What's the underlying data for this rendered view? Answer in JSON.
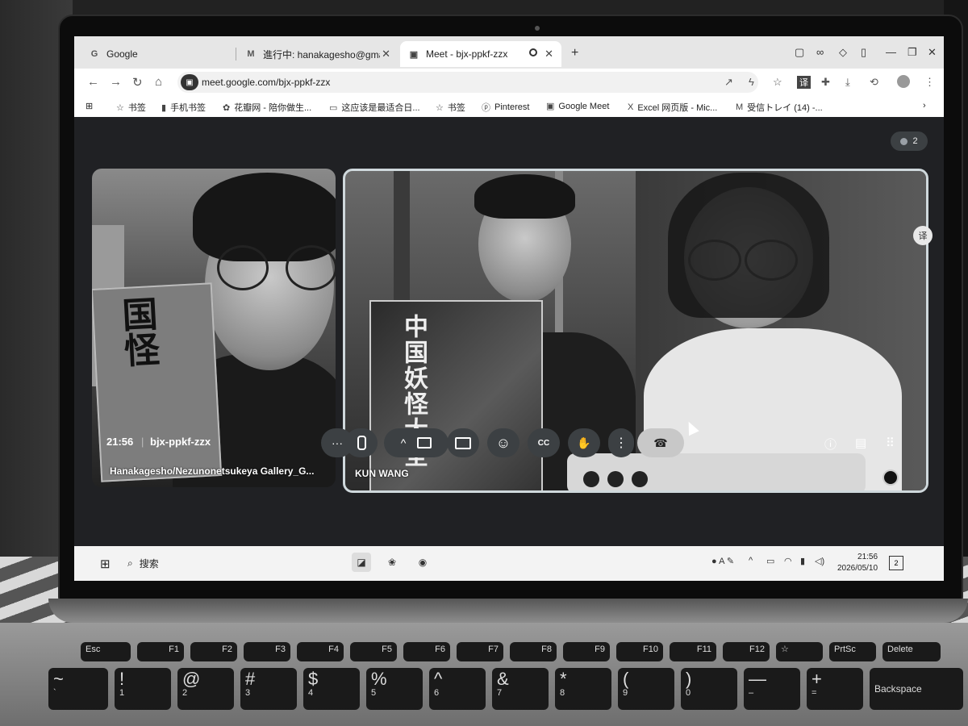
{
  "browser": {
    "tabs": [
      {
        "title": "Google",
        "favicon": "G",
        "icon": "google-icon"
      },
      {
        "title": "進行中: hanakagesho@gmail.",
        "favicon": "M",
        "icon": "gmail-icon"
      },
      {
        "title": "Meet - bjx-ppkf-zzx",
        "favicon": "▣",
        "icon": "meet-icon"
      }
    ],
    "new_tab": "+",
    "url": "meet.google.com/bjx-ppkf-zzx",
    "bookmarks": [
      {
        "label": "书签",
        "icon": "star-icon"
      },
      {
        "label": "手机书签",
        "icon": "mobile-icon"
      },
      {
        "label": "花瓣网 - 陪你做生...",
        "icon": "huaban-icon"
      },
      {
        "label": "这应该是最适合日...",
        "icon": "bilibili-icon"
      },
      {
        "label": "书签",
        "icon": "star-icon"
      },
      {
        "label": "Pinterest",
        "icon": "pinterest-icon"
      },
      {
        "label": "Google Meet",
        "icon": "meet-icon"
      },
      {
        "label": "Excel 网页版 - Mic...",
        "icon": "excel-icon"
      },
      {
        "label": "受信トレイ (14) -...",
        "icon": "gmail-icon"
      }
    ],
    "more_bookmarks": "›"
  },
  "meet": {
    "participant_count": "2",
    "participants": [
      {
        "name": "Hanakagesho/Nezunonetsukeya Gallery_G..."
      },
      {
        "name": "KUN WANG"
      }
    ],
    "book_left_title": "国怪",
    "book_right_title": "中国妖怪大全",
    "translate_label": "译",
    "time": "21:56",
    "separator": "|",
    "meeting_code": "bjx-ppkf-zzx",
    "controls": [
      {
        "id": "more-options",
        "symbol": "···"
      },
      {
        "id": "mic",
        "symbol": "🎤"
      },
      {
        "id": "expand",
        "symbol": "^"
      },
      {
        "id": "camera",
        "symbol": "■"
      },
      {
        "id": "present",
        "symbol": "⇡"
      },
      {
        "id": "reactions",
        "symbol": "☺"
      },
      {
        "id": "captions",
        "symbol": "CC"
      },
      {
        "id": "raise-hand",
        "symbol": "✋"
      },
      {
        "id": "overflow",
        "symbol": "⋮"
      },
      {
        "id": "end-call",
        "symbol": "☎"
      }
    ]
  },
  "taskbar": {
    "search_placeholder": "搜索",
    "time": "21:56",
    "date": "2026/05/10",
    "notification_count": "2"
  },
  "keyboard": {
    "fn_row": [
      "Esc",
      "F1",
      "F2",
      "F3",
      "F4",
      "F5",
      "F6",
      "F7",
      "F8",
      "F9",
      "F10",
      "F11",
      "F12",
      "PrtSc",
      "Delete"
    ],
    "fn_sub": [
      "",
      "Ins"
    ],
    "num_row": [
      {
        "top": "~",
        "bottom": "`"
      },
      {
        "top": "!",
        "bottom": "1"
      },
      {
        "top": "@",
        "bottom": "2"
      },
      {
        "top": "#",
        "bottom": "3"
      },
      {
        "top": "$",
        "bottom": "4"
      },
      {
        "top": "%",
        "bottom": "5"
      },
      {
        "top": "^",
        "bottom": "6"
      },
      {
        "top": "&",
        "bottom": "7"
      },
      {
        "top": "*",
        "bottom": "8"
      },
      {
        "top": "(",
        "bottom": "9"
      },
      {
        "top": ")",
        "bottom": "0"
      },
      {
        "top": "—",
        "bottom": "–"
      },
      {
        "top": "+",
        "bottom": "="
      }
    ],
    "backspace": "Backspace"
  }
}
